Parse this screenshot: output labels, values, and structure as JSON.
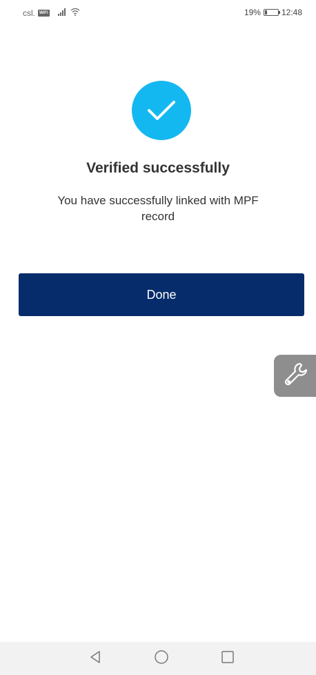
{
  "status_bar": {
    "carrier": "csl.",
    "wifi_badge": "WiFi",
    "battery_text": "19%",
    "battery_level": 0.19,
    "time": "12:48"
  },
  "result": {
    "title": "Verified successfully",
    "message": "You have successfully linked with MPF record",
    "icon": "check-icon",
    "icon_color": "#14b8f0"
  },
  "actions": {
    "done_label": "Done",
    "button_color": "#062c6b"
  },
  "floating_tool": {
    "icon": "wrench-icon"
  },
  "nav_bar": {
    "back_icon": "back-triangle-icon",
    "home_icon": "home-circle-icon",
    "recents_icon": "recents-square-icon"
  }
}
